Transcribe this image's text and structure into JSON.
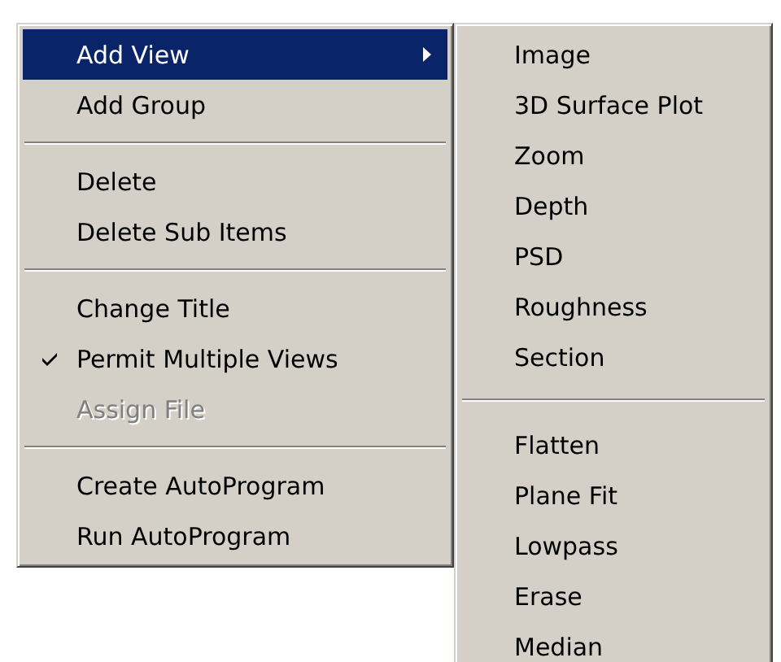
{
  "context_menu": {
    "items": [
      {
        "kind": "item",
        "label": "Add View",
        "selected": true,
        "submenu": true
      },
      {
        "kind": "item",
        "label": "Add Group",
        "selected": false
      },
      {
        "kind": "separator"
      },
      {
        "kind": "item",
        "label": "Delete",
        "selected": false
      },
      {
        "kind": "item",
        "label": "Delete Sub Items",
        "selected": false
      },
      {
        "kind": "separator"
      },
      {
        "kind": "item",
        "label": "Change Title",
        "selected": false
      },
      {
        "kind": "item",
        "label": "Permit Multiple Views",
        "selected": false,
        "checked": true
      },
      {
        "kind": "item",
        "label": "Assign File",
        "selected": false,
        "disabled": true
      },
      {
        "kind": "separator"
      },
      {
        "kind": "item",
        "label": "Create AutoProgram",
        "selected": false
      },
      {
        "kind": "item",
        "label": "Run AutoProgram",
        "selected": false
      }
    ]
  },
  "submenu": {
    "items": [
      {
        "kind": "item",
        "label": "Image",
        "selected": false
      },
      {
        "kind": "item",
        "label": "3D Surface Plot",
        "selected": false
      },
      {
        "kind": "item",
        "label": "Zoom",
        "selected": false
      },
      {
        "kind": "item",
        "label": "Depth",
        "selected": false
      },
      {
        "kind": "item",
        "label": "PSD",
        "selected": false
      },
      {
        "kind": "item",
        "label": "Roughness",
        "selected": false
      },
      {
        "kind": "item",
        "label": "Section",
        "selected": false
      },
      {
        "kind": "separator"
      },
      {
        "kind": "item",
        "label": "Flatten",
        "selected": false
      },
      {
        "kind": "item",
        "label": "Plane Fit",
        "selected": false
      },
      {
        "kind": "item",
        "label": "Lowpass",
        "selected": false
      },
      {
        "kind": "item",
        "label": "Erase",
        "selected": false
      },
      {
        "kind": "item",
        "label": "Median",
        "selected": false
      }
    ]
  }
}
